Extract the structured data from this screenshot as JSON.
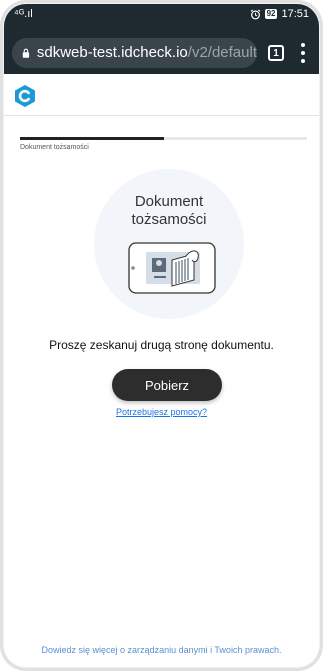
{
  "status_bar": {
    "signal": "⁴ᴳ.ıl",
    "battery": "92",
    "time": "17:51"
  },
  "browser": {
    "url_host": "sdkweb-test.idcheck.io",
    "url_path": "/v2/default",
    "tab_count": "1"
  },
  "progress": {
    "fraction": 0.5,
    "step_label": "Dokument tożsamości"
  },
  "illustration": {
    "title_line1": "Dokument",
    "title_line2": "tożsamości"
  },
  "main": {
    "instruction": "Proszę zeskanuj drugą stronę dokumentu.",
    "primary_button": "Pobierz",
    "help_link": "Potrzebujesz pomocy?"
  },
  "footer": {
    "link": "Dowiedz się więcej o zarządzaniu danymi i Twoich prawach."
  },
  "colors": {
    "brand": "#1a9ad6",
    "button": "#2d2d2d",
    "link": "#1a73e8"
  }
}
